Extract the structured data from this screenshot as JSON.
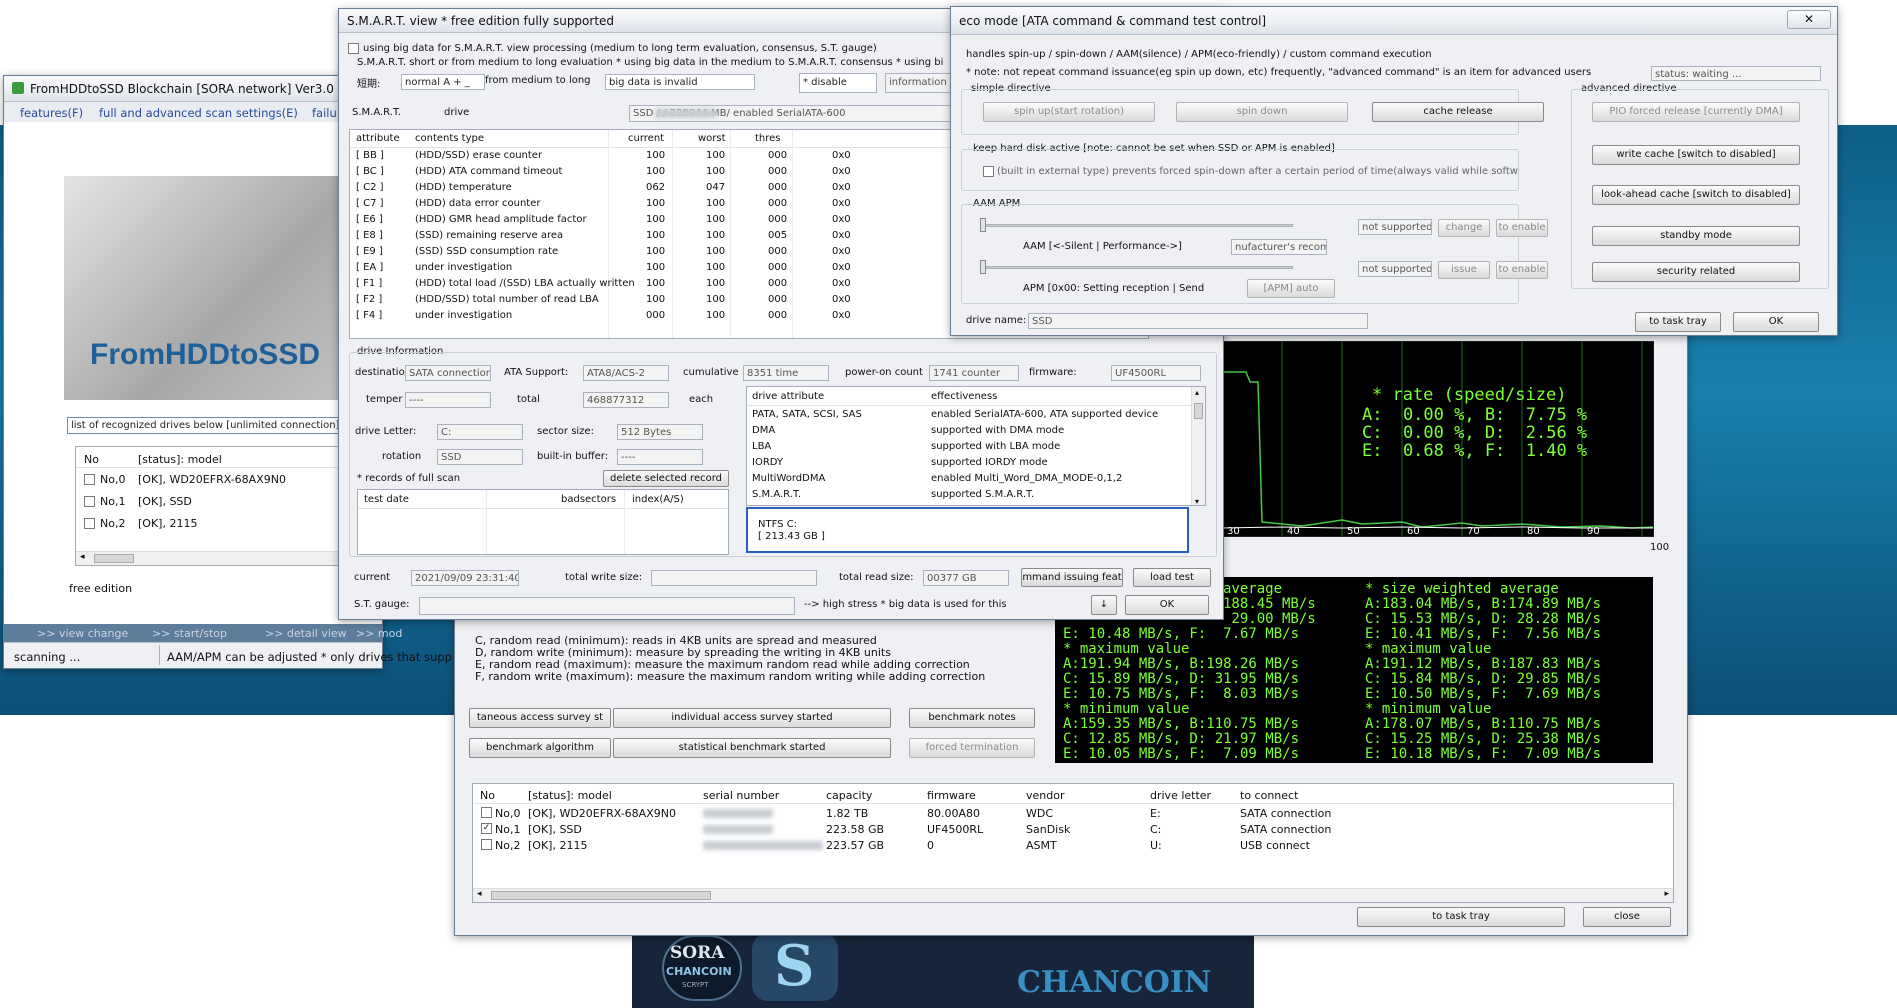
{
  "colors": {
    "terminal_text": "#7dff34",
    "terminal_bg": "#000000",
    "window_title": "#eef0f3",
    "accent": "#1a7fae"
  },
  "main_window": {
    "title": "FromHDDtoSSD Blockchain [SORA network] Ver3.0",
    "menu": [
      "features(F)",
      "full and advanced scan settings(E)",
      "failu"
    ],
    "banner_text": "FromHDDtoSSD",
    "drive_list_label": "list of recognized drives below [unlimited connection]",
    "columns": [
      "No",
      "[status]: model"
    ],
    "drives": [
      {
        "no": "No,0",
        "model": "[OK], WD20EFRX-68AX9N0"
      },
      {
        "no": "No,1",
        "model": "[OK], SSD"
      },
      {
        "no": "No,2",
        "model": "[OK], 2115"
      }
    ],
    "edition": "free edition",
    "bottom_nav": [
      ">> view change",
      ">> start/stop",
      ">> detail view",
      ">> mod"
    ],
    "status_left": "scanning ...",
    "status_right": "AAM/APM can be adjusted * only drives that supp"
  },
  "smart": {
    "title": "S.M.A.R.T. view * free edition fully supported",
    "big_data_check": "using big data for S.M.A.R.T. view processing (medium to long term evaluation, consensus, S.T. gauge)",
    "eval_note": "S.M.A.R.T. short or from medium to long evaluation * using big data in the medium to S.M.A.R.T. consensus * using bi",
    "short_label": "短期:",
    "short_value": "normal A + _",
    "medium_label": "from medium to long",
    "medium_value": "big data is invalid",
    "disable_label": "* disable",
    "information_label": "information",
    "smart_label": "S.M.A.R.T.",
    "drive_label": "drive",
    "drive_value": "SSD /                    / 228944 MB/ enabled SerialATA-600",
    "columns": [
      "attribute",
      "contents type",
      "current",
      "worst",
      "thres"
    ],
    "rows": [
      {
        "id": "[ BB ]",
        "type": "(HDD/SSD) erase counter",
        "cur": "100",
        "worst": "100",
        "thres": "000",
        "raw": "0x0"
      },
      {
        "id": "[ BC ]",
        "type": "(HDD) ATA command timeout",
        "cur": "100",
        "worst": "100",
        "thres": "000",
        "raw": "0x0"
      },
      {
        "id": "[ C2 ]",
        "type": "(HDD) temperature",
        "cur": "062",
        "worst": "047",
        "thres": "000",
        "raw": "0x0"
      },
      {
        "id": "[ C7 ]",
        "type": "(HDD) data error counter",
        "cur": "100",
        "worst": "100",
        "thres": "000",
        "raw": "0x0"
      },
      {
        "id": "[ E6 ]",
        "type": "(HDD) GMR head amplitude factor",
        "cur": "100",
        "worst": "100",
        "thres": "000",
        "raw": "0x0"
      },
      {
        "id": "[ E8 ]",
        "type": "(SSD) remaining reserve area",
        "cur": "100",
        "worst": "100",
        "thres": "005",
        "raw": "0x0"
      },
      {
        "id": "[ E9 ]",
        "type": "(SSD) SSD consumption rate",
        "cur": "100",
        "worst": "100",
        "thres": "000",
        "raw": "0x0"
      },
      {
        "id": "[ EA ]",
        "type": "under investigation",
        "cur": "100",
        "worst": "100",
        "thres": "000",
        "raw": "0x0"
      },
      {
        "id": "[ F1 ]",
        "type": "(HDD) total load /(SSD) LBA actually written",
        "cur": "100",
        "worst": "100",
        "thres": "000",
        "raw": "0x0"
      },
      {
        "id": "[ F2 ]",
        "type": "(HDD/SSD) total number of read LBA",
        "cur": "100",
        "worst": "100",
        "thres": "000",
        "raw": "0x0"
      },
      {
        "id": "[ F4 ]",
        "type": "under investigation",
        "cur": "000",
        "worst": "100",
        "thres": "000",
        "raw": "0x0"
      }
    ],
    "drive_info_label": "drive Information",
    "destination_label": "destinatio",
    "destination_value": "SATA connection",
    "ata_support_label": "ATA Support:",
    "ata_support_value": "ATA8/ACS-2",
    "cumulative_label": "cumulative",
    "cumulative_value": "8351 time",
    "power_on_label": "power-on count",
    "power_on_value": "1741 counter",
    "firmware_label": "firmware:",
    "firmware_value": "UF4500RL",
    "temper_label": "temper",
    "temper_value": "----",
    "total_label": "total",
    "total_value": "468877312",
    "each_label": "each",
    "drive_letter_label": "drive Letter:",
    "drive_letter_value": "C:",
    "sector_size_label": "sector size:",
    "sector_size_value": "512 Bytes",
    "rotation_label": "rotation",
    "rotation_value": "SSD",
    "buffer_label": "built-in buffer:",
    "buffer_value": "----",
    "records_label": "* records of full scan",
    "delete_btn": "delete selected record",
    "record_cols": [
      "test date",
      "badsectors",
      "index(A/S)"
    ],
    "attr_cols": [
      "drive attribute",
      "effectiveness"
    ],
    "attributes": [
      {
        "name": "PATA, SATA, SCSI, SAS",
        "eff": "enabled SerialATA-600, ATA supported device"
      },
      {
        "name": "DMA",
        "eff": "supported with DMA mode"
      },
      {
        "name": "LBA",
        "eff": "supported with LBA mode"
      },
      {
        "name": "IORDY",
        "eff": "supported IORDY mode"
      },
      {
        "name": "MultiWordDMA",
        "eff": "enabled Multi_Word_DMA_MODE-0,1,2"
      },
      {
        "name": "S.M.A.R.T.",
        "eff": "supported S.M.A.R.T."
      }
    ],
    "ntfs_line1": "NTFS C:",
    "ntfs_line2": "[ 213.43 GB ]",
    "current_label": "current",
    "current_value": "2021/09/09 23:31:40",
    "total_write_label": "total write size:",
    "total_write_value": "",
    "total_read_label": "total read size:",
    "total_read_value": "00377 GB",
    "command_btn": "mmand issuing feat",
    "load_test_btn": "load test",
    "gauge_label": "S.T. gauge:",
    "gauge_note": "--> high stress * big data is used for this",
    "down_btn": "↓",
    "ok_btn": "OK"
  },
  "eco": {
    "title": "eco mode [ATA command & command test control]",
    "desc1": "handles spin-up / spin-down / AAM(silence) / APM(eco-friendly) / custom command execution",
    "desc2": "* note: not repeat command issuance(eg spin up  down, etc) frequently, \"advanced command\" is an item for advanced users",
    "status": "status: waiting ...",
    "simple_label": "simple directive",
    "advanced_label": "advanced directive",
    "spin_up": "spin up(start rotation)",
    "spin_down": "spin down",
    "cache_release": "cache release",
    "pio_btn": "PIO forced release [currently DMA]",
    "keep_active": "keep hard disk active [note: cannot be set when SSD or APM is enabled]",
    "built_in": "(built in  external type) prevents forced spin-down after a certain period of time(always valid while softw",
    "write_cache": "write cache [switch to disabled]",
    "look_ahead": "look-ahead cache [switch to disabled]",
    "aam_apm": "AAM  APM",
    "aam_label": "AAM [<-Silent | Performance->]",
    "aam_field": "nufacturer's recom",
    "not_supported": "not supported",
    "change": "change",
    "to_enable": "to enable",
    "apm_label": "APM [0x00: Setting reception | Send",
    "apm_field": "[APM] auto",
    "issue": "issue",
    "standby": "standby mode",
    "security": "security related",
    "drive_name_label": "drive name:",
    "drive_name_value": "SSD",
    "task_tray": "to task tray",
    "ok": "OK"
  },
  "bench": {
    "rate_lines": [
      "* rate (speed/size)",
      "A:  0.00 %, B:  7.75 %",
      "C:  0.00 %, D:  2.56 %",
      "E:  0.68 %, F:  1.40 %"
    ],
    "x_ticks": [
      "30",
      "40",
      "50",
      "60",
      "70",
      "80",
      "90"
    ],
    "x_max": "100",
    "stats_left": [
      "average",
      "188.45 MB/s",
      " 29.00 MB/s",
      "E: 10.48 MB/s, F:  7.67 MB/s",
      "* maximum value",
      "A:191.94 MB/s, B:198.26 MB/s",
      "C: 15.89 MB/s, D: 31.95 MB/s",
      "E: 10.75 MB/s, F:  8.03 MB/s",
      "* minimum value",
      "A:159.35 MB/s, B:110.75 MB/s",
      "C: 12.85 MB/s, D: 21.97 MB/s",
      "E: 10.05 MB/s, F:  7.09 MB/s"
    ],
    "stats_right": [
      "* size weighted average",
      "A:183.04 MB/s, B:174.89 MB/s",
      "C: 15.53 MB/s, D: 28.28 MB/s",
      "E: 10.41 MB/s, F:  7.56 MB/s",
      "* maximum value",
      "A:191.12 MB/s, B:187.83 MB/s",
      "C: 15.84 MB/s, D: 29.85 MB/s",
      "E: 10.50 MB/s, F:  7.69 MB/s",
      "* minimum value",
      "A:178.07 MB/s, B:110.75 MB/s",
      "C: 15.25 MB/s, D: 25.38 MB/s",
      "E: 10.18 MB/s, F:  7.09 MB/s"
    ],
    "legend": [
      "C, random read (minimum): reads in 4KB units are spread and measured",
      "D, random write (minimum): measure by spreading the writing in 4KB units",
      "E, random read (maximum): measure the maximum random read while adding correction",
      "F, random write (maximum): measure the maximum random writing while adding correction"
    ],
    "simul_btn": "taneous access survey st",
    "individual_btn": "individual access survey started",
    "notes_btn": "benchmark notes",
    "algo_btn": "benchmark algorithm",
    "stat_btn": "statistical benchmark started",
    "forced_btn": "forced termination",
    "columns": [
      "No",
      "[status]: model",
      "serial number",
      "capacity",
      "firmware",
      "vendor",
      "drive letter",
      "to connect"
    ],
    "drives": [
      {
        "checked": false,
        "no": "No,0",
        "model": "[OK], WD20EFRX-68AX9N0",
        "cap": "1.82 TB",
        "fw": "80.00A80",
        "vendor": "WDC",
        "letter": "E:",
        "conn": "SATA connection"
      },
      {
        "checked": true,
        "no": "No,1",
        "model": "[OK], SSD",
        "cap": "223.58 GB",
        "fw": "UF4500RL",
        "vendor": "SanDisk",
        "letter": "C:",
        "conn": "SATA connection"
      },
      {
        "checked": false,
        "no": "No,2",
        "model": "[OK], 2115",
        "cap": "223.57 GB",
        "fw": "0",
        "vendor": "ASMT",
        "letter": "U:",
        "conn": "USB connect"
      }
    ],
    "task_tray": "to task tray",
    "close": "close"
  },
  "sora_logo": {
    "line1": "SORA",
    "line2": "CHANCOIN",
    "line3": "SCRYPT",
    "big": "CHANCOIN"
  }
}
